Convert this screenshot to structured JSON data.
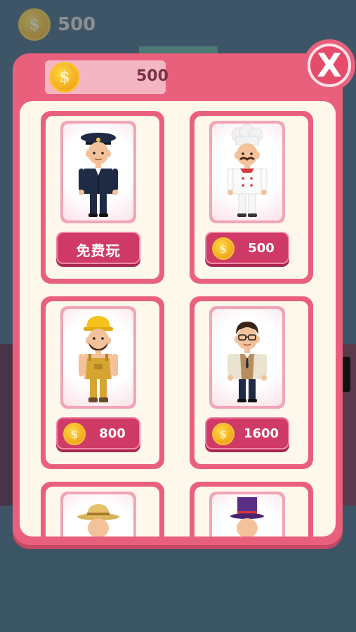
{
  "background": {
    "coin_amount": "500"
  },
  "shop": {
    "coin_balance": "500",
    "close_symbol": "X",
    "coin_symbol": "$"
  },
  "characters": [
    {
      "id": "police",
      "label": "免费玩",
      "type": "free"
    },
    {
      "id": "chef",
      "label": "500",
      "type": "price"
    },
    {
      "id": "construction-worker",
      "label": "800",
      "type": "price"
    },
    {
      "id": "teacher",
      "label": "1600",
      "type": "price"
    },
    {
      "id": "farmer",
      "label": "",
      "type": "partial"
    },
    {
      "id": "magician",
      "label": "",
      "type": "partial"
    }
  ],
  "colors": {
    "accent_pink": "#e9607d",
    "button_pink": "#d03a67",
    "coin_gold": "#f4a81a",
    "cream": "#fdf7ec"
  }
}
